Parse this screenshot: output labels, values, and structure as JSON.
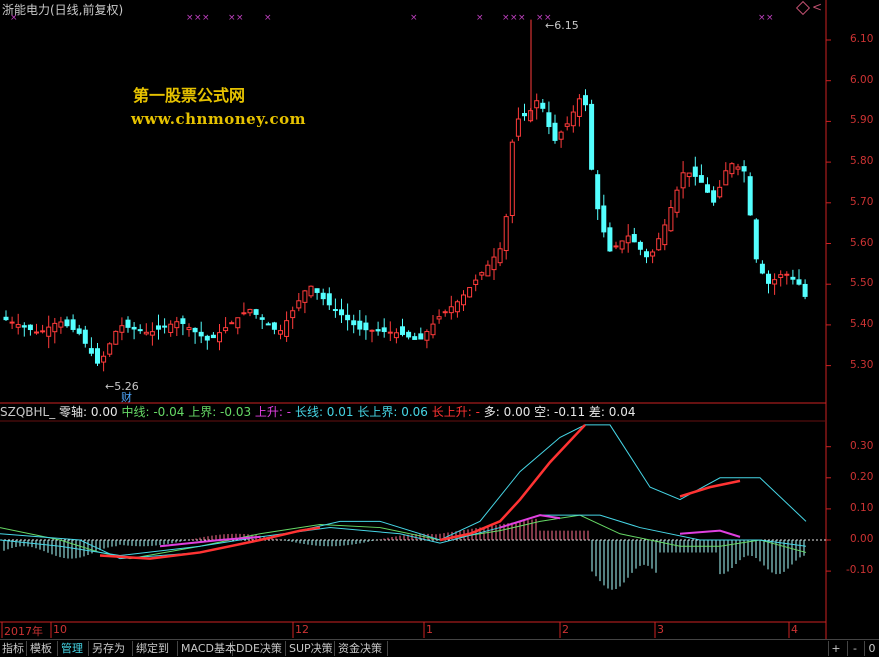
{
  "header": {
    "title": "浙能电力(日线,前复权)",
    "right_label": "<"
  },
  "watermark": {
    "line1": "第一股票公式网",
    "line2": "www.chnmoney.com"
  },
  "price_chart": {
    "high_label": "6.15",
    "low_label": "5.26",
    "low_tag": "财",
    "y_ticks": [
      "6.10",
      "6.00",
      "5.90",
      "5.80",
      "5.70",
      "5.60",
      "5.50",
      "5.40",
      "5.30"
    ]
  },
  "indicator": {
    "legend": [
      {
        "text": "SZQBHL_",
        "color": "#c8c8c8"
      },
      {
        "text": " 零轴: 0.00",
        "color": "#e8e8e8"
      },
      {
        "text": "  中线: -0.04",
        "color": "#66d966"
      },
      {
        "text": "  上界: -0.03",
        "color": "#66d966"
      },
      {
        "text": "  上升: -",
        "color": "#e040e0"
      },
      {
        "text": "  长线: 0.01",
        "color": "#46d6e6"
      },
      {
        "text": "  长上界: 0.06",
        "color": "#46d6e6"
      },
      {
        "text": "  长上升: -",
        "color": "#ff3333"
      },
      {
        "text": "  多: 0.00",
        "color": "#e8e8e8"
      },
      {
        "text": "  空: -0.11",
        "color": "#e8e8e8"
      },
      {
        "text": "  差: 0.04",
        "color": "#e8e8e8"
      }
    ],
    "y_ticks": [
      "0.30",
      "0.20",
      "0.10",
      "0.00",
      "-0.10"
    ]
  },
  "time_axis": [
    {
      "label": "2017年"
    },
    {
      "label": "10"
    },
    {
      "label": "12"
    },
    {
      "label": "1"
    },
    {
      "label": "2"
    },
    {
      "label": "3"
    },
    {
      "label": "4"
    }
  ],
  "tabs": [
    {
      "label": "指标",
      "active": false
    },
    {
      "label": "模板",
      "active": false
    },
    {
      "label": "管理",
      "active": true
    },
    {
      "label": "另存为",
      "active": false
    },
    {
      "label": "绑定到",
      "active": false
    },
    {
      "label": "MACD基本",
      "active": false
    },
    {
      "label": "DDE决策",
      "active": false
    },
    {
      "label": "SUP决策",
      "active": false
    },
    {
      "label": "资金决策",
      "active": false
    }
  ],
  "nav_buttons": [
    "+",
    "-",
    "0"
  ],
  "colors": {
    "up": "#ff3b3b",
    "down": "#54ffff",
    "axis": "#cc2222",
    "marker": "#c040c0"
  }
}
